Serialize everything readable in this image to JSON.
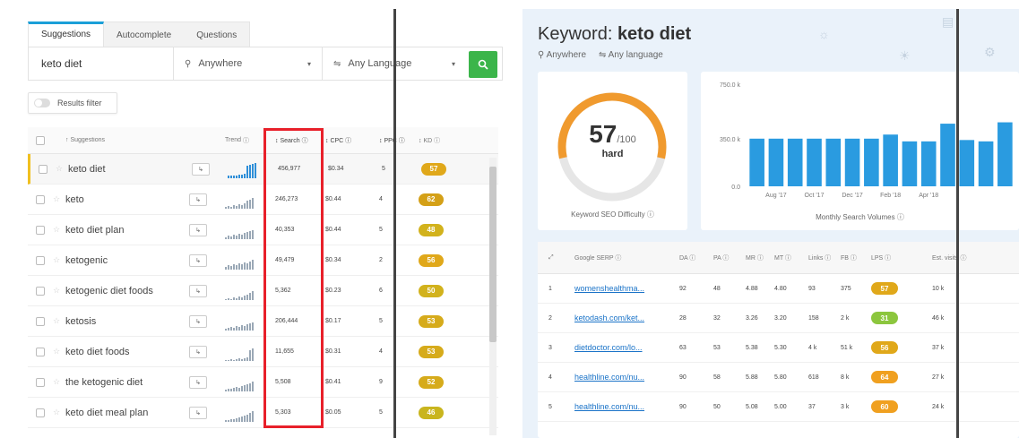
{
  "left": {
    "tabs": [
      {
        "label": "Suggestions",
        "active": true
      },
      {
        "label": "Autocomplete",
        "active": false
      },
      {
        "label": "Questions",
        "active": false
      }
    ],
    "search": {
      "keyword": "keto diet",
      "location": "Anywhere",
      "language": "Any Language"
    },
    "filter_label": "Results filter",
    "columns": [
      "Suggestions",
      "Trend",
      "Search",
      "CPC",
      "PPC",
      "KD"
    ],
    "rows": [
      {
        "keyword": "keto diet",
        "search": "456,977",
        "cpc": "$0.34",
        "ppc": "5",
        "kd": "57",
        "kd_color": "#e0a81a"
      },
      {
        "keyword": "keto",
        "search": "246,273",
        "cpc": "$0.44",
        "ppc": "4",
        "kd": "62",
        "kd_color": "#d4a017"
      },
      {
        "keyword": "keto diet plan",
        "search": "40,353",
        "cpc": "$0.44",
        "ppc": "5",
        "kd": "48",
        "kd_color": "#d2b21c"
      },
      {
        "keyword": "ketogenic",
        "search": "49,479",
        "cpc": "$0.34",
        "ppc": "2",
        "kd": "56",
        "kd_color": "#e0a81a"
      },
      {
        "keyword": "ketogenic diet foods",
        "search": "5,362",
        "cpc": "$0.23",
        "ppc": "6",
        "kd": "50",
        "kd_color": "#d2b21c"
      },
      {
        "keyword": "ketosis",
        "search": "206,444",
        "cpc": "$0.17",
        "ppc": "5",
        "kd": "53",
        "kd_color": "#d6ab1b"
      },
      {
        "keyword": "keto diet foods",
        "search": "11,655",
        "cpc": "$0.31",
        "ppc": "4",
        "kd": "53",
        "kd_color": "#d6ab1b"
      },
      {
        "keyword": "the ketogenic diet",
        "search": "5,508",
        "cpc": "$0.41",
        "ppc": "9",
        "kd": "52",
        "kd_color": "#d6ab1b"
      },
      {
        "keyword": "keto diet meal plan",
        "search": "5,303",
        "cpc": "$0.05",
        "ppc": "5",
        "kd": "46",
        "kd_color": "#c9b51e"
      }
    ]
  },
  "right": {
    "title_prefix": "Keyword: ",
    "title_keyword": "keto diet",
    "location": "Anywhere",
    "language": "Any language",
    "kd": {
      "score": "57",
      "max": "/100",
      "label": "hard",
      "caption": "Keyword SEO Difficulty",
      "fraction": 0.57,
      "color": "#f09a2e"
    },
    "volume_caption": "Monthly Search Volumes",
    "serp": {
      "columns": [
        "Google SERP",
        "DA",
        "PA",
        "MR",
        "MT",
        "Links",
        "FB",
        "LPS",
        "Est. visits"
      ],
      "rows": [
        {
          "n": "1",
          "url": "womenshealthma...",
          "da": "92",
          "pa": "48",
          "mr": "4.88",
          "mt": "4.80",
          "links": "93",
          "fb": "375",
          "lps": "57",
          "lps_color": "#e0a81a",
          "visits": "10 k"
        },
        {
          "n": "2",
          "url": "ketodash.com/ket...",
          "da": "28",
          "pa": "32",
          "mr": "3.26",
          "mt": "3.20",
          "links": "158",
          "fb": "2 k",
          "lps": "31",
          "lps_color": "#8cc63e",
          "visits": "46 k"
        },
        {
          "n": "3",
          "url": "dietdoctor.com/lo...",
          "da": "63",
          "pa": "53",
          "mr": "5.38",
          "mt": "5.30",
          "links": "4 k",
          "fb": "51 k",
          "lps": "56",
          "lps_color": "#e0a81a",
          "visits": "37 k"
        },
        {
          "n": "4",
          "url": "healthline.com/nu...",
          "da": "90",
          "pa": "58",
          "mr": "5.88",
          "mt": "5.80",
          "links": "618",
          "fb": "8 k",
          "lps": "64",
          "lps_color": "#f0a020",
          "visits": "27 k"
        },
        {
          "n": "5",
          "url": "healthline.com/nu...",
          "da": "90",
          "pa": "50",
          "mr": "5.08",
          "mt": "5.00",
          "links": "37",
          "fb": "3 k",
          "lps": "60",
          "lps_color": "#f0a020",
          "visits": "24 k"
        }
      ]
    }
  },
  "chart_data": {
    "type": "bar",
    "title": "",
    "caption": "Monthly Search Volumes",
    "xlabel": "",
    "ylabel": "",
    "y_ticks": [
      "0.0",
      "350.0 k",
      "750.0 k"
    ],
    "x_tick_labels": [
      "Aug '17",
      "Oct '17",
      "Dec '17",
      "Feb '18",
      "Apr '18"
    ],
    "ylim": [
      0,
      750
    ],
    "values": [
      350,
      350,
      350,
      350,
      350,
      350,
      350,
      380,
      330,
      330,
      460,
      340,
      330,
      470
    ],
    "color": "#2a9be0",
    "grid": false
  }
}
